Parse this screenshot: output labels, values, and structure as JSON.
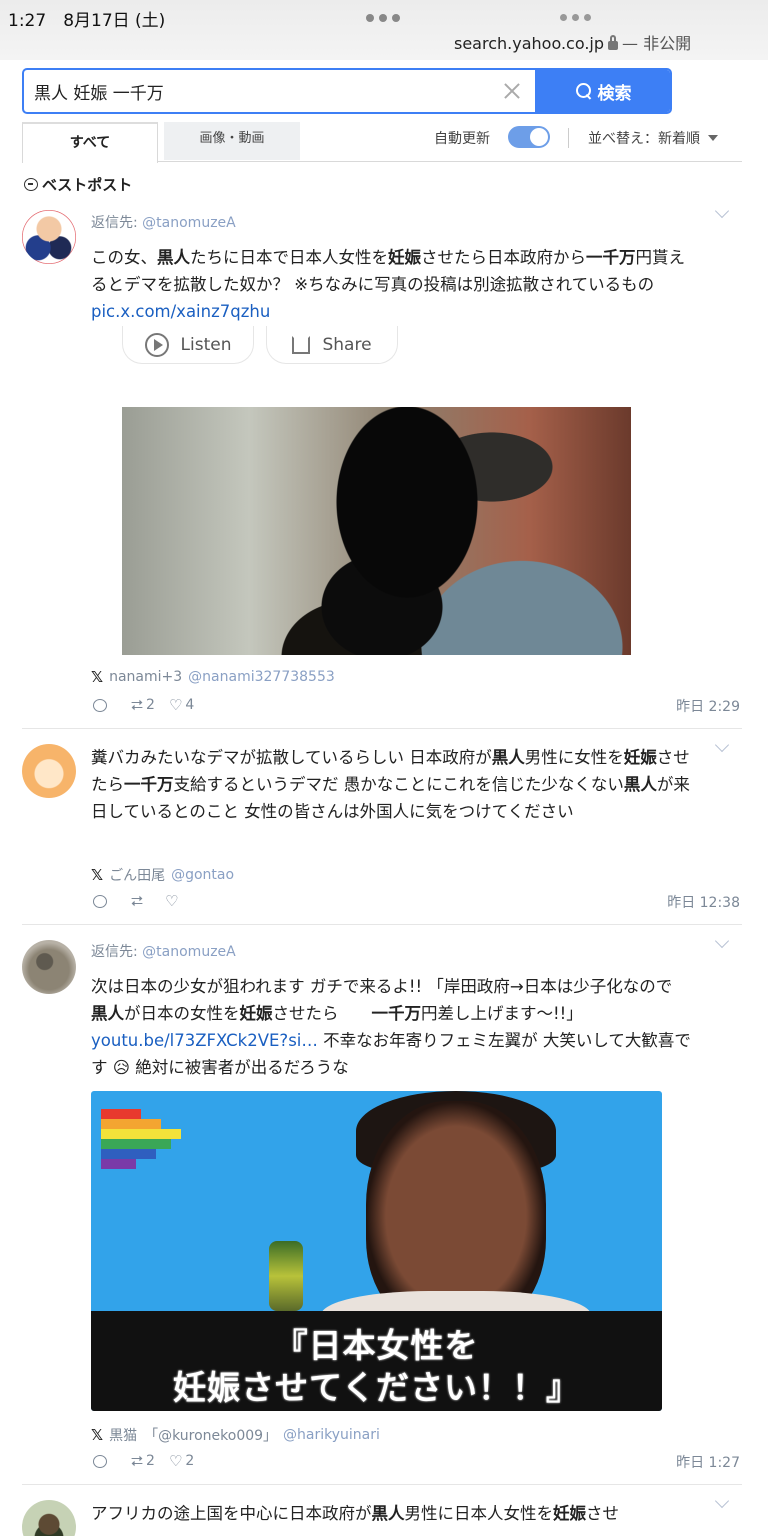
{
  "status": {
    "time": "1:27",
    "date": "8月17日 (土)",
    "url": "search.yahoo.co.jp",
    "privacy": "— 非公開"
  },
  "search": {
    "query": "黒人 妊娠 一千万",
    "button_label": "検索"
  },
  "tabs": {
    "all": "すべて",
    "media": "画像・動画",
    "auto_refresh": "自動更新",
    "sort": "並べ替え：新着順"
  },
  "best_heading": "ベストポスト",
  "posts": [
    {
      "reply_prefix": "返信先:",
      "reply_handle": "@tanomuzeA",
      "text_parts": [
        "この女、",
        "黒人",
        "たちに日本で日本人女性を",
        "妊娠",
        "させたら日本政府から",
        "一千万",
        "円貰えるとデマを拡散した奴か？ ※ちなみに写真の投稿は別途拡散されているもの "
      ],
      "link": "pic.x.com/xainz7qzhu",
      "listen": "Listen",
      "share": "Share",
      "author_name": "nanami+3",
      "author_handle": "@nanami327738553",
      "retweets": "2",
      "likes": "4",
      "time": "昨日 2:29"
    },
    {
      "text_parts": [
        "糞バカみたいなデマが拡散しているらしい 日本政府が",
        "黒人",
        "男性に女性を",
        "妊娠",
        "させたら",
        "一千万",
        "支給するというデマだ 愚かなことにこれを信じた少なくない",
        "黒人",
        "が来日しているとのこと 女性の皆さんは外国人に気をつけてください"
      ],
      "author_name": "ごん田尾",
      "author_handle": "@gontao",
      "time": "昨日 12:38"
    },
    {
      "reply_prefix": "返信先:",
      "reply_handle": "@tanomuzeA",
      "text_parts": [
        "次は日本の少女が狙われます ガチで来るよ!! 「岸田政府→日本は少子化なので　",
        "黒人",
        "が日本の女性を",
        "妊娠",
        "させたら　　",
        "一千万",
        "円差し上げます〜!!」 "
      ],
      "link": "youtu.be/l73ZFXCk2VE?si…",
      "text_after": " 不幸なお年寄りフェミ左翼が 大笑いして大歓喜です 😥 絶対に被害者が出るだろうな",
      "caption_line1": "『日本女性を",
      "caption_line2": "妊娠させてください！！』",
      "author_name": "黒猫　「@kuroneko009」",
      "author_handle": "@harikyuinari",
      "retweets": "2",
      "likes": "2",
      "time": "昨日 1:27"
    },
    {
      "text_line1_parts": [
        "アフリカの途上国を中心に日本政府が",
        "黒人",
        "男性に日本人女性を",
        "妊娠",
        "させ"
      ]
    }
  ],
  "icons": {
    "search": "search-icon",
    "clear": "close-icon",
    "reply": "reply-icon",
    "retweet": "retweet-icon",
    "like": "heart-icon",
    "x_logo": "x-logo-icon"
  },
  "colors": {
    "accent": "#3d7ff5",
    "link": "#1a5fc1",
    "meta": "#7c8897"
  }
}
